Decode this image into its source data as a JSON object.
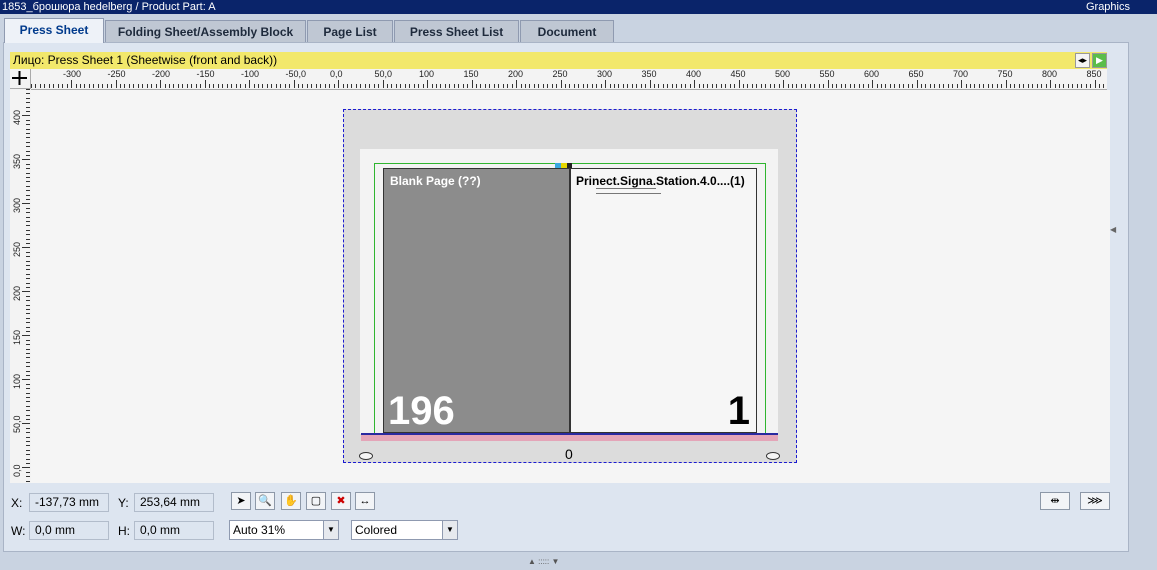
{
  "window": {
    "title": "1853_брошюра hedelberg / Product Part: A",
    "right_label": "Graphics"
  },
  "tabs": [
    {
      "label": "Press Sheet",
      "active": true
    },
    {
      "label": "Folding Sheet/Assembly Block",
      "active": false
    },
    {
      "label": "Page List",
      "active": false
    },
    {
      "label": "Press Sheet List",
      "active": false
    },
    {
      "label": "Document",
      "active": false
    }
  ],
  "sheet_bar": {
    "label": "Лицо:  Press Sheet 1 (Sheetwise (front and back))",
    "color": "#f2e86b"
  },
  "ruler": {
    "h_ticks": [
      "-300",
      "-250",
      "-200",
      "-150",
      "-100",
      "-50,0",
      "0,0",
      "50,0",
      "100",
      "150",
      "200",
      "250",
      "300",
      "350",
      "400",
      "450",
      "500",
      "550",
      "600",
      "650",
      "700",
      "750",
      "800",
      "850"
    ],
    "v_ticks": [
      "400",
      "350",
      "300",
      "250",
      "200",
      "150",
      "100",
      "50,0",
      "0,0"
    ]
  },
  "pages": {
    "left": {
      "title": "Blank Page (??)",
      "number": "196",
      "color": "#8c8c8c"
    },
    "right": {
      "title": "Prinect.Signa.Station.4.0....(1)",
      "number": "1",
      "color": "#f6f6f6"
    }
  },
  "sheet_center_mark": "0",
  "coords": {
    "x_label": "X:",
    "x_value": "-137,73 mm",
    "y_label": "Y:",
    "y_value": "253,64 mm",
    "w_label": "W:",
    "w_value": "0,0 mm",
    "h_label": "H:",
    "h_value": "0,0 mm"
  },
  "tools": [
    {
      "name": "select-tool-icon",
      "glyph": "➤"
    },
    {
      "name": "zoom-tool-icon",
      "glyph": "🔍"
    },
    {
      "name": "hand-tool-icon",
      "glyph": "✋"
    },
    {
      "name": "frame-tool-icon",
      "glyph": "▢"
    },
    {
      "name": "delete-mark-icon",
      "glyph": "✖"
    },
    {
      "name": "distance-tool-icon",
      "glyph": "↔"
    }
  ],
  "zoom_select": {
    "value": "Auto 31%"
  },
  "color_select": {
    "value": "Colored"
  },
  "accent_color": "#003a8c"
}
